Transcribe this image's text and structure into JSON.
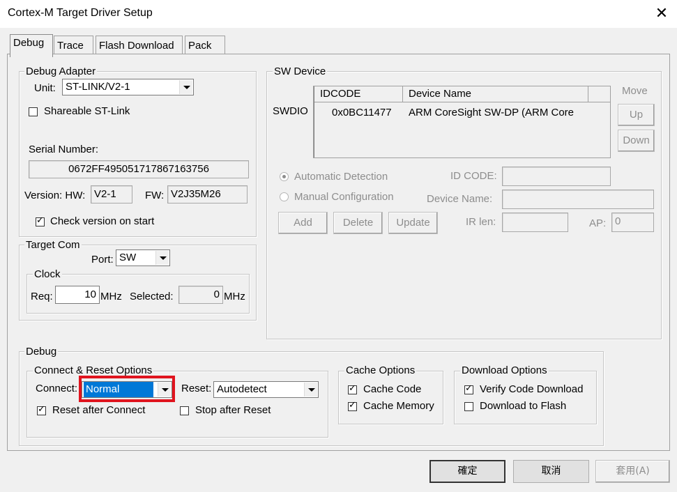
{
  "window": {
    "title": "Cortex-M Target Driver Setup",
    "close": "✕"
  },
  "tabs": [
    "Debug",
    "Trace",
    "Flash Download",
    "Pack"
  ],
  "debug_adapter": {
    "title": "Debug Adapter",
    "unit_label": "Unit:",
    "unit_value": "ST-LINK/V2-1",
    "shareable_label": "Shareable ST-Link",
    "shareable_checked": false,
    "serial_label": "Serial Number:",
    "serial_value": "0672FF495051717867163756",
    "version_label": "Version: HW:",
    "hw_value": "V2-1",
    "fw_label": "FW:",
    "fw_value": "V2J35M26",
    "check_version_label": "Check version on start",
    "check_version_checked": true
  },
  "target_com": {
    "title": "Target Com",
    "port_label": "Port:",
    "port_value": "SW",
    "clock_title": "Clock",
    "req_label": "Req:",
    "req_value": "10",
    "mhz1": "MHz",
    "selected_label": "Selected:",
    "selected_value": "0",
    "mhz2": "MHz"
  },
  "sw_device": {
    "title": "SW Device",
    "row_label": "SWDIO",
    "col_idcode": "IDCODE",
    "col_device": "Device Name",
    "idcode": "0x0BC11477",
    "device_name": "ARM CoreSight SW-DP (ARM Core",
    "move_label": "Move",
    "up": "Up",
    "down": "Down",
    "auto_detect": "Automatic Detection",
    "manual_config": "Manual Configuration",
    "id_code_label": "ID CODE:",
    "device_name_label": "Device Name:",
    "ir_len_label": "IR len:",
    "ap_label": "AP:",
    "ap_value": "0",
    "add": "Add",
    "delete": "Delete",
    "update": "Update"
  },
  "debug": {
    "title": "Debug",
    "connect_reset_title": "Connect & Reset Options",
    "connect_label": "Connect:",
    "connect_value": "Normal",
    "reset_label": "Reset:",
    "reset_value": "Autodetect",
    "reset_after_connect": "Reset after Connect",
    "reset_after_connect_checked": true,
    "stop_after_reset": "Stop after Reset",
    "stop_after_reset_checked": false,
    "cache_title": "Cache Options",
    "cache_code": "Cache Code",
    "cache_memory": "Cache Memory",
    "download_title": "Download Options",
    "verify_download": "Verify Code Download",
    "download_flash": "Download to Flash"
  },
  "buttons": {
    "ok": "確定",
    "cancel": "取消",
    "apply": "套用(A)"
  },
  "colors": {
    "highlight": "#e0141e",
    "selection": "#0078d7"
  }
}
